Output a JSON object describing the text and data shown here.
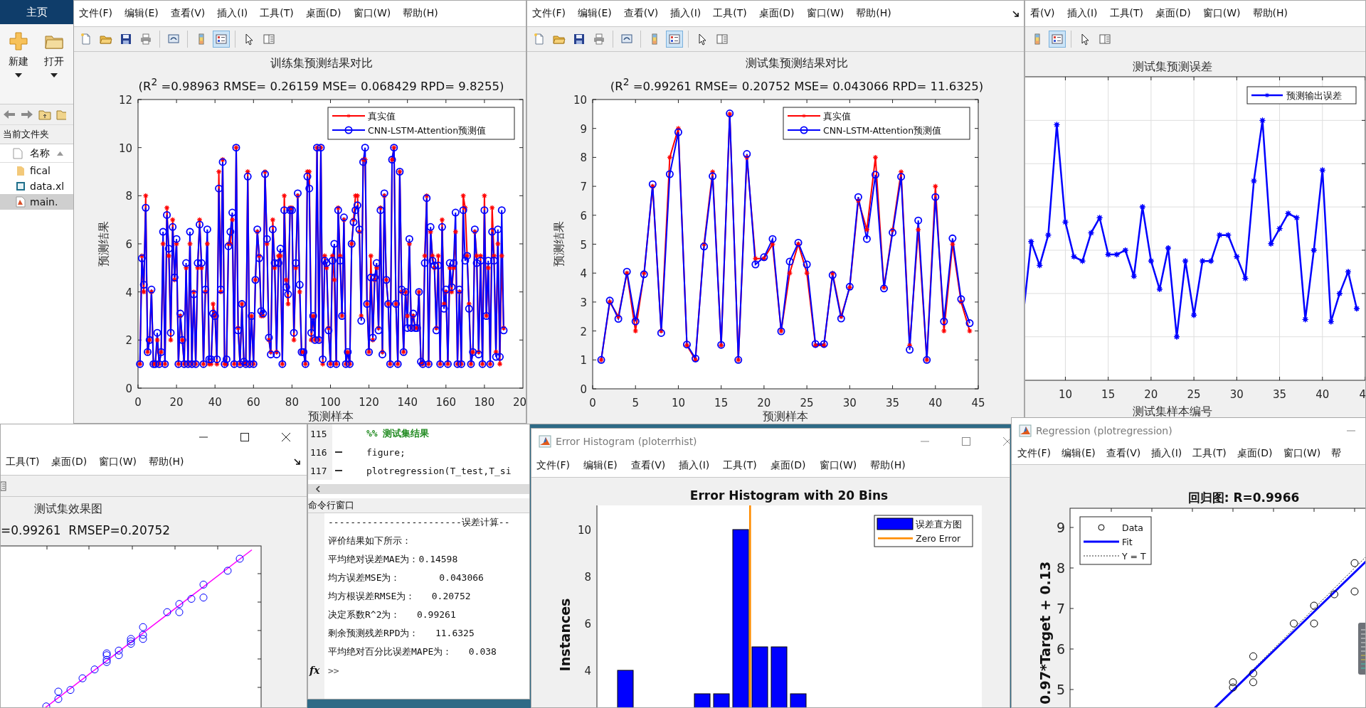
{
  "desktop": {
    "tab": "主页",
    "ribbon_buttons": [
      {
        "label": "新建",
        "kind": "new"
      },
      {
        "label": "打开",
        "kind": "open"
      }
    ],
    "folder_panel_title": "当前文件夹",
    "name_column": "名称",
    "files": [
      {
        "name": "fical",
        "kind": "folder",
        "selected": false
      },
      {
        "name": "data.xl",
        "kind": "spreadsheet",
        "selected": false
      },
      {
        "name": "main.",
        "kind": "script",
        "selected": true
      }
    ]
  },
  "train_figure": {
    "menu": [
      "文件(F)",
      "编辑(E)",
      "查看(V)",
      "插入(I)",
      "工具(T)",
      "桌面(D)",
      "窗口(W)",
      "帮助(H)"
    ],
    "legend_button_on": true,
    "edge_tick_label": "20",
    "subtitle": "(R$^{2}$ =0.98963 RMSE= 0.26159 MSE= 0.068429 RPD= 9.8255)",
    "chart_data": {
      "type": "line",
      "title": "训练集预测结果对比",
      "xlabel": "预测样本",
      "ylabel": "预测结果",
      "legend": "upper right",
      "x": [
        1,
        2,
        3,
        4,
        5,
        6,
        7,
        8,
        9,
        10,
        11,
        12,
        13,
        14,
        15,
        16,
        17,
        18,
        19,
        20,
        21,
        22,
        23,
        24,
        25,
        26,
        27,
        28,
        29,
        30,
        31,
        32,
        33,
        34,
        35,
        36,
        37,
        38,
        39,
        40,
        41,
        42,
        43,
        44,
        45,
        46,
        47,
        48,
        49,
        50,
        51,
        52,
        53,
        54,
        55,
        56,
        57,
        58,
        59,
        60,
        61,
        62,
        63,
        64,
        65,
        66,
        67,
        68,
        69,
        70,
        71,
        72,
        73,
        74,
        75,
        76,
        77,
        78,
        79,
        80,
        81,
        82,
        83,
        84,
        85,
        86,
        87,
        88,
        89,
        90,
        91,
        92,
        93,
        94,
        95,
        96,
        97,
        98,
        99,
        100,
        101,
        102,
        103,
        104,
        105,
        106,
        107,
        108,
        109,
        110,
        111,
        112,
        113,
        114,
        115,
        116,
        117,
        118,
        119,
        120,
        121,
        122,
        123,
        124,
        125,
        126,
        127,
        128,
        129,
        130,
        131,
        132,
        133,
        134,
        135,
        136,
        137,
        138,
        139,
        140,
        141,
        142,
        143,
        144,
        145,
        146,
        147,
        148,
        149,
        150,
        151,
        152,
        153,
        154,
        155,
        156,
        157,
        158,
        159,
        160,
        161,
        162,
        163,
        164,
        165,
        166,
        167,
        168,
        169,
        170,
        171,
        172,
        173,
        174,
        175,
        176,
        177,
        178,
        179,
        180,
        181,
        182,
        183,
        184,
        185,
        186,
        187,
        188,
        189,
        190
      ],
      "xlim": [
        0,
        200
      ],
      "ylim": [
        0,
        12
      ],
      "xticks": [
        0,
        20,
        40,
        60,
        80,
        100,
        120,
        140,
        160,
        180
      ],
      "yticks": [
        0,
        2,
        4,
        6,
        8,
        10,
        12
      ],
      "series": [
        {
          "name": "真实值",
          "color": "#ff0000",
          "marker": "star",
          "values": [
            1,
            5.5,
            4,
            8,
            1.5,
            2,
            4,
            1,
            1,
            2,
            1,
            1.5,
            6,
            1,
            7.5,
            5.5,
            2,
            7,
            4.5,
            6,
            1,
            3,
            2,
            1,
            5,
            1,
            6,
            1,
            4,
            1,
            5,
            7,
            5,
            1,
            4,
            6,
            1,
            1,
            3.5,
            3,
            1,
            9,
            4,
            9.5,
            1,
            1,
            6,
            6,
            7,
            1,
            10,
            2.5,
            1,
            3.5,
            1,
            1,
            9,
            1,
            3,
            1,
            4.5,
            6.5,
            5.5,
            3,
            3,
            9,
            6,
            2,
            1.5,
            7,
            5,
            1.5,
            5.5,
            5.5,
            1,
            8,
            4.5,
            3.5,
            7.5,
            7.5,
            2,
            5,
            8,
            4,
            1.5,
            1.5,
            1,
            9,
            9,
            2,
            3,
            2,
            10,
            2,
            10,
            1,
            5.5,
            5,
            2.5,
            1,
            5.5,
            4.5,
            1,
            7.5,
            5.5,
            3,
            7,
            1,
            1.5,
            1,
            6,
            7,
            8,
            8,
            6.5,
            3,
            9.5,
            9.5,
            3.5,
            1.5,
            5.5,
            2,
            4.5,
            5,
            2.5,
            7.5,
            1.5,
            8,
            4.5,
            3.5,
            1,
            9.5,
            10,
            3.5,
            1,
            9,
            4,
            1.5,
            4,
            3,
            6,
            2.5,
            3,
            2.5,
            2.5,
            4,
            1,
            1,
            5.5,
            8,
            1,
            6.5,
            5.5,
            5,
            2.5,
            5.5,
            1,
            7,
            3.5,
            4,
            1,
            5,
            4,
            5,
            6.5,
            1,
            4,
            1,
            8,
            7.5,
            5.5,
            3.5,
            1,
            1.5,
            6.5,
            5.5,
            1.5,
            5.5,
            1,
            8,
            3,
            5,
            1,
            7.5,
            5.5,
            1.5,
            6,
            1,
            5.5,
            2.5
          ]
        },
        {
          "name": "CNN-LSTM-Attention预测值",
          "color": "#0000ff",
          "marker": "circle",
          "values": [
            1,
            5.4,
            4.3,
            7.5,
            1.5,
            2,
            4.1,
            1,
            1,
            2.3,
            1,
            1.5,
            6.5,
            1,
            7.2,
            5.8,
            2.3,
            6.7,
            4.6,
            6.2,
            1,
            3.1,
            2,
            1,
            5.2,
            1,
            6.5,
            1,
            3.9,
            1,
            5.2,
            6.8,
            5.2,
            1,
            4.1,
            6.6,
            1.2,
            1.2,
            3.1,
            3,
            1.2,
            8.3,
            4.1,
            9.4,
            1,
            1.2,
            5.9,
            6.5,
            7.3,
            1,
            10,
            2.4,
            1,
            3.5,
            1.1,
            1,
            8.8,
            1,
            3,
            1,
            4.5,
            6.6,
            5.4,
            3.2,
            3.1,
            8.9,
            6.2,
            2.1,
            1.4,
            6.6,
            5.2,
            1.4,
            5.2,
            5.8,
            1,
            7.4,
            4.2,
            3.9,
            7.4,
            7.4,
            2.3,
            5.2,
            8.1,
            4.3,
            1.5,
            1.5,
            1,
            8.8,
            8.3,
            2.3,
            3,
            2,
            10,
            2,
            10,
            1.2,
            5.3,
            5.2,
            2.4,
            1,
            5.3,
            6,
            1,
            7.4,
            5.3,
            3,
            7.1,
            1,
            1.5,
            1,
            6,
            6.9,
            7.4,
            7.6,
            6.6,
            2.8,
            9.4,
            10,
            3.5,
            1.5,
            4.6,
            2.1,
            4.6,
            5.2,
            2.4,
            7.4,
            1.4,
            8.1,
            4.5,
            3.5,
            1,
            9.5,
            10,
            3.5,
            1,
            9,
            4.1,
            1.5,
            4,
            2.5,
            6.2,
            2.5,
            3.1,
            2.5,
            2.5,
            4,
            1.1,
            1,
            5.2,
            7.9,
            1,
            6.7,
            5.3,
            5.1,
            2.4,
            5.1,
            1,
            6.7,
            3.3,
            4.1,
            1,
            5.2,
            4.2,
            5.2,
            7.3,
            1,
            4.1,
            1,
            7.4,
            5.3,
            5.5,
            3.3,
            1,
            1.5,
            6.6,
            5.2,
            1.4,
            5.3,
            1,
            7.4,
            3,
            5.3,
            1,
            6.5,
            5.3,
            1.3,
            6.6,
            1.3,
            7.4,
            2.4
          ]
        }
      ]
    }
  },
  "test_figure": {
    "menu": [
      "文件(F)",
      "编辑(E)",
      "查看(V)",
      "插入(I)",
      "工具(T)",
      "桌面(D)",
      "窗口(W)",
      "帮助(H)"
    ],
    "legend_button_on": true,
    "subtitle": "(R$^{2}$ =0.99261 RMSE= 0.20752 MSE= 0.043066 RPD= 11.6325)",
    "chart_data": {
      "type": "line",
      "title": "测试集预测结果对比",
      "xlabel": "预测样本",
      "ylabel": "预测结果",
      "legend": "upper right",
      "x": [
        1,
        2,
        3,
        4,
        5,
        6,
        7,
        8,
        9,
        10,
        11,
        12,
        13,
        14,
        15,
        16,
        17,
        18,
        19,
        20,
        21,
        22,
        23,
        24,
        25,
        26,
        27,
        28,
        29,
        30,
        31,
        32,
        33,
        34,
        35,
        36,
        37,
        38,
        39,
        40,
        41,
        42,
        43,
        44
      ],
      "xlim": [
        0,
        45
      ],
      "ylim": [
        0,
        10
      ],
      "xticks": [
        0,
        5,
        10,
        15,
        20,
        25,
        30,
        35,
        40,
        45
      ],
      "yticks": [
        0,
        1,
        2,
        3,
        4,
        5,
        6,
        7,
        8,
        9,
        10
      ],
      "series": [
        {
          "name": "真实值",
          "color": "#ff0000",
          "marker": "star",
          "values": [
            1,
            3,
            2.5,
            4,
            2,
            4,
            7,
            2,
            8,
            9,
            1.5,
            1,
            5,
            7.5,
            1.5,
            9.5,
            1,
            8,
            4.5,
            4.5,
            5,
            2,
            4,
            5,
            4,
            1.5,
            1.5,
            4,
            2.5,
            3.5,
            6.5,
            5.5,
            8,
            3.5,
            5.5,
            7.5,
            1.5,
            5.5,
            1,
            7,
            2,
            5,
            3,
            2
          ]
        },
        {
          "name": "CNN-LSTM-Attention预测值",
          "color": "#0000ff",
          "marker": "circle",
          "values": [
            1,
            3.05,
            2.42,
            4.05,
            2.33,
            3.96,
            7.07,
            1.93,
            7.42,
            8.87,
            1.53,
            1.05,
            4.92,
            7.35,
            1.52,
            9.52,
            1,
            8.12,
            4.3,
            4.55,
            5.18,
            1.99,
            4.4,
            5.05,
            4.3,
            1.55,
            1.55,
            3.93,
            2.43,
            3.53,
            6.63,
            5.18,
            7.4,
            3.47,
            5.4,
            7.33,
            1.35,
            5.82,
            1,
            6.63,
            2.33,
            5.2,
            3.1,
            2.27
          ]
        }
      ]
    }
  },
  "error_figure": {
    "menu": [
      "看(V)",
      "插入(I)",
      "工具(T)",
      "桌面(D)",
      "窗口(W)",
      "帮助(H)"
    ],
    "legend_button_on": true,
    "title": "测试集预测误差",
    "legend": "预测输出误差",
    "x_tick_labels": [
      "10",
      "15",
      "20",
      "25",
      "30",
      "35",
      "40",
      "4"
    ],
    "xlabel": "测试集样本编号"
  },
  "effect_figure": {
    "menu": [
      "工具(T)",
      "桌面(D)",
      "窗口(W)",
      "帮助(H)"
    ],
    "title": "测试集效果图",
    "subtitle": "=0.99261  RMSEP=0.20752"
  },
  "editor": {
    "lines": [
      {
        "number": "115",
        "code": "%% 测试集结果",
        "kind": "comment",
        "executable": false
      },
      {
        "number": "116",
        "code": "figure;",
        "kind": "code",
        "executable": true
      },
      {
        "number": "117",
        "code": "plotregression(T_test,T_si",
        "kind": "code",
        "executable": true
      }
    ]
  },
  "command_window": {
    "title": "命令行窗口",
    "lines": [
      "------------------------误差计算--",
      "评价结果如下所示：",
      "平均绝对误差MAE为：0.14598",
      "均方误差MSE为：       0.043066",
      "均方根误差RMSE为：   0.20752",
      "决定系数R^2为：   0.99261",
      "剩余预测残差RPD为：   11.6325",
      "平均绝对百分比误差MAPE为：   0.038"
    ],
    "function_button": "fx",
    "prompt": ">>"
  },
  "histogram_window": {
    "title": "Error Histogram (ploterrhist)",
    "menu": [
      "文件(F)",
      "编辑(E)",
      "查看(V)",
      "插入(I)",
      "工具(T)",
      "桌面(D)",
      "窗口(W)",
      "帮助(H)"
    ],
    "plot_title": "Error Histogram with 20 Bins",
    "ylabel": "Instances",
    "y_tick_labels": [
      "10",
      "8",
      "6",
      "4"
    ],
    "legend": [
      {
        "label": "误差直方图",
        "kind": "bars",
        "color": "#0000ff"
      },
      {
        "label": "Zero Error",
        "kind": "zero_line",
        "color": "#ff8c00"
      }
    ]
  },
  "regression_window": {
    "title": "Regression (plotregression)",
    "menu": [
      "文件(F)",
      "编辑(E)",
      "查看(V)",
      "插入(I)",
      "工具(T)",
      "桌面(D)",
      "窗口(W)",
      "帮"
    ],
    "plot_title": "回归图: R=0.9966",
    "ylabel": "0.97*Target + 0.13",
    "y_tick_labels": [
      "9",
      "8",
      "7",
      "6",
      "5"
    ],
    "legend": [
      {
        "label": "Data",
        "kind": "data"
      },
      {
        "label": "Fit",
        "kind": "fit"
      },
      {
        "label": "Y = T",
        "kind": "identity"
      }
    ]
  }
}
